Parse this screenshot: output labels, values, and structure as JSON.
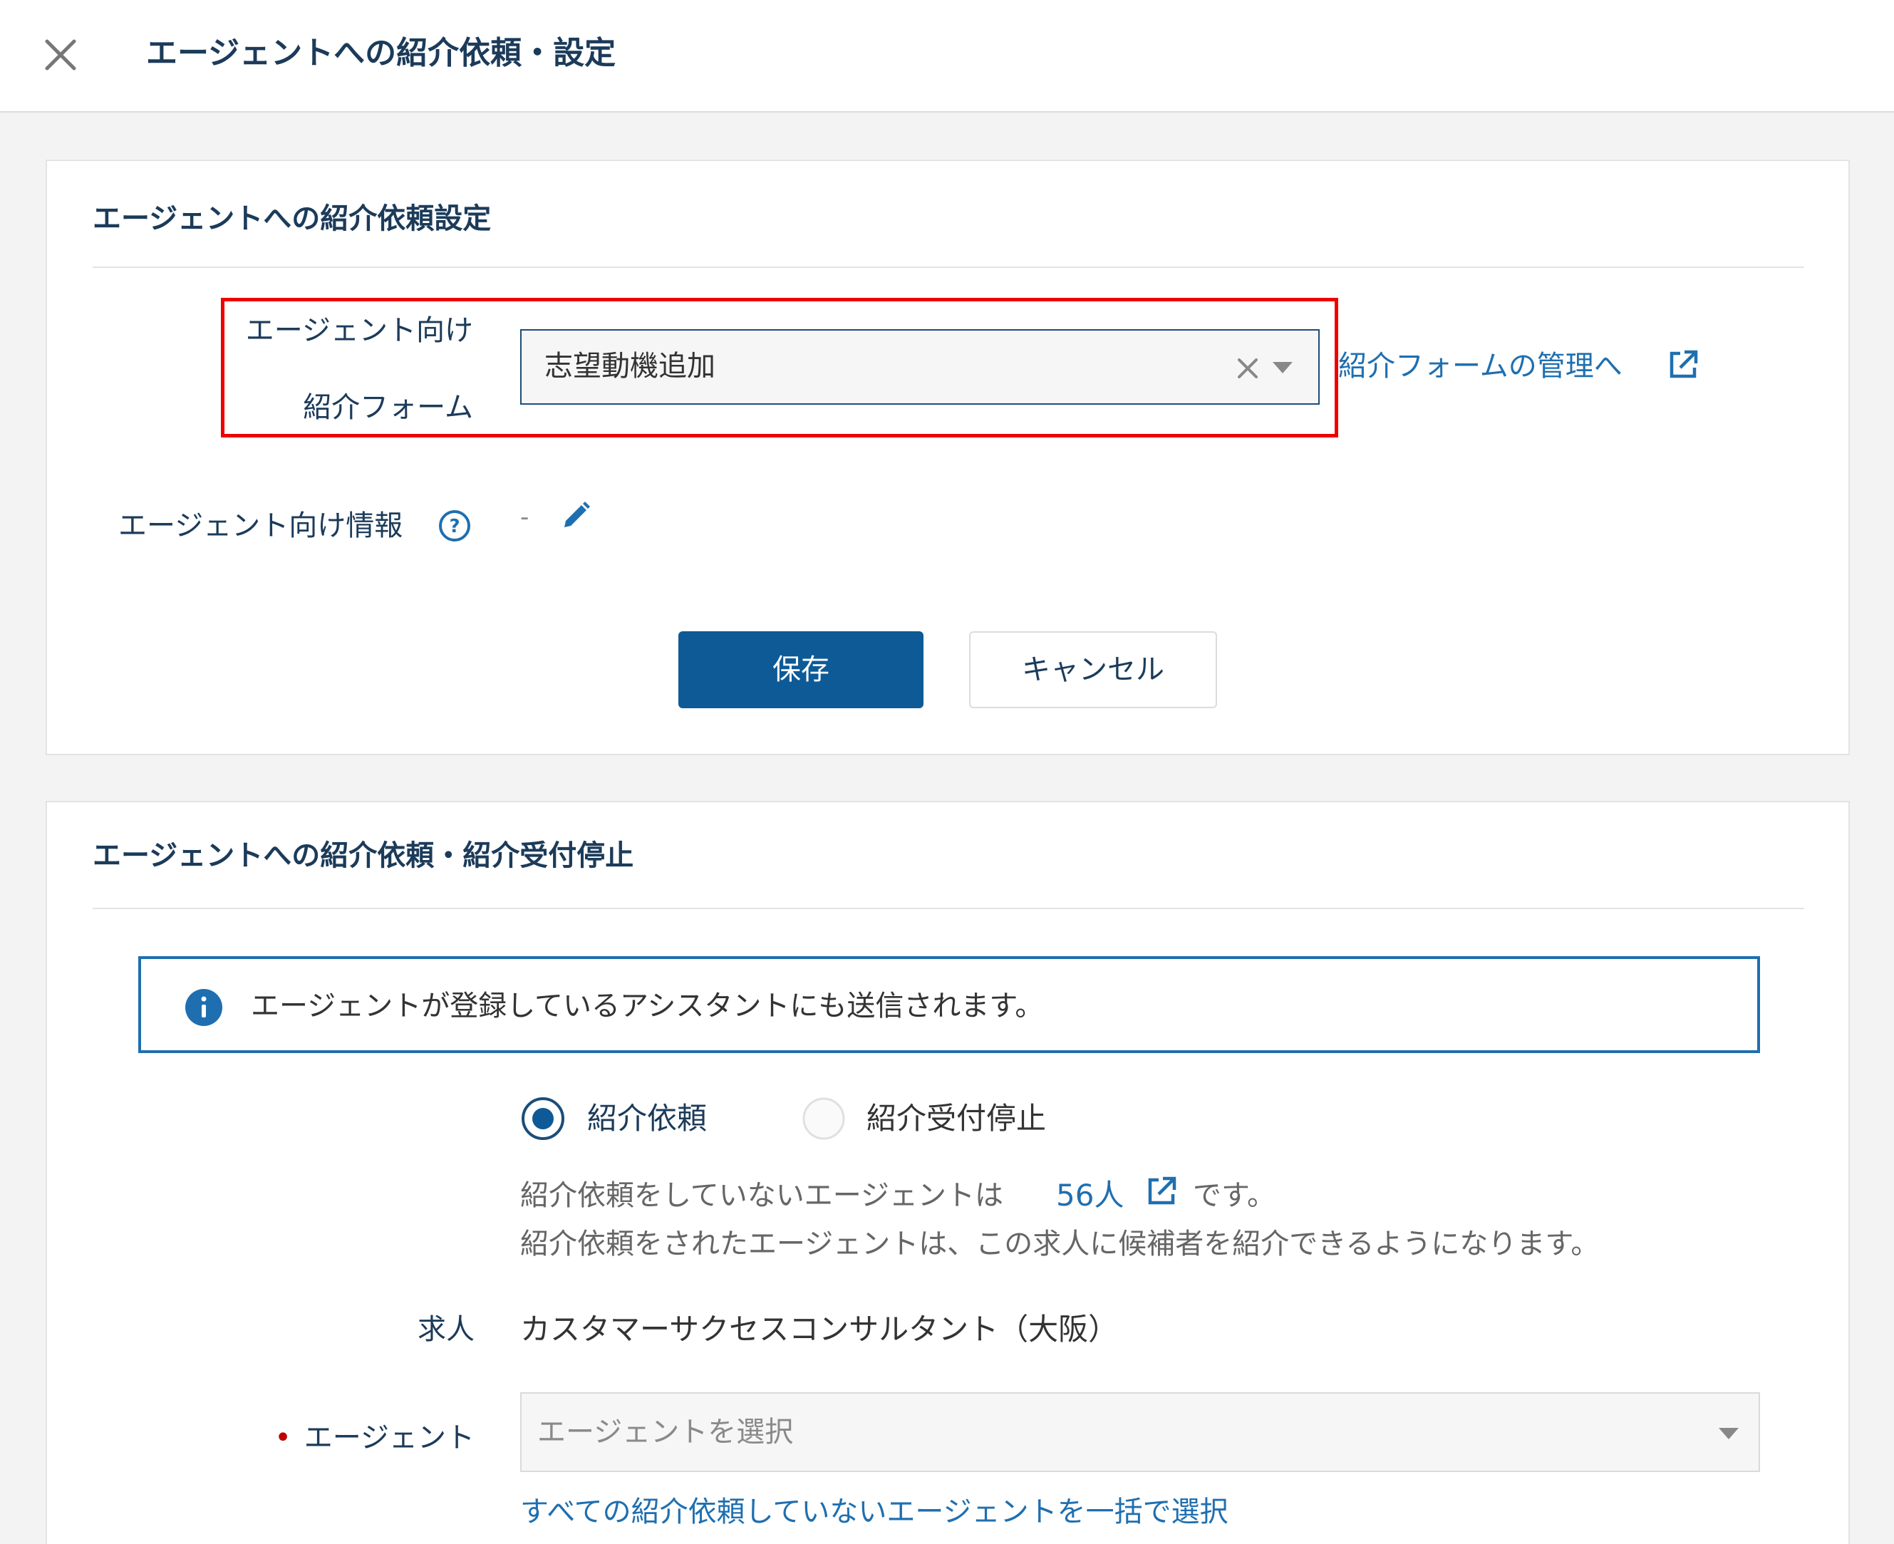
{
  "header": {
    "title": "エージェントへの紹介依頼・設定"
  },
  "settings": {
    "title": "エージェントへの紹介依頼設定",
    "form_label_line1": "エージェント向け",
    "form_label_line2": "紹介フォーム",
    "form_select_value": "志望動機追加",
    "manage_link": "紹介フォームの管理へ",
    "info_label": "エージェント向け情報",
    "info_value": "-",
    "save_label": "保存",
    "cancel_label": "キャンセル",
    "highlight_color": "#ee0000",
    "primary_color": "#0d5a96"
  },
  "request": {
    "title": "エージェントへの紹介依頼・紹介受付停止",
    "notice": "エージェントが登録しているアシスタントにも送信されます。",
    "radio_options": [
      {
        "label": "紹介依頼",
        "selected": true
      },
      {
        "label": "紹介受付停止",
        "selected": false
      }
    ],
    "desc_prefix": "紹介依頼をしていないエージェントは",
    "desc_count": "56人",
    "desc_suffix": "です。",
    "desc_line2": "紹介依頼をされたエージェントは、この求人に候補者を紹介できるようになります。",
    "job_label": "求人",
    "job_value": "カスタマーサクセスコンサルタント（大阪）",
    "required_mark": "•",
    "agent_label": "エージェント",
    "agent_placeholder": "エージェントを選択",
    "bulk_select_link": "すべての紹介依頼していないエージェントを一括で選択"
  }
}
